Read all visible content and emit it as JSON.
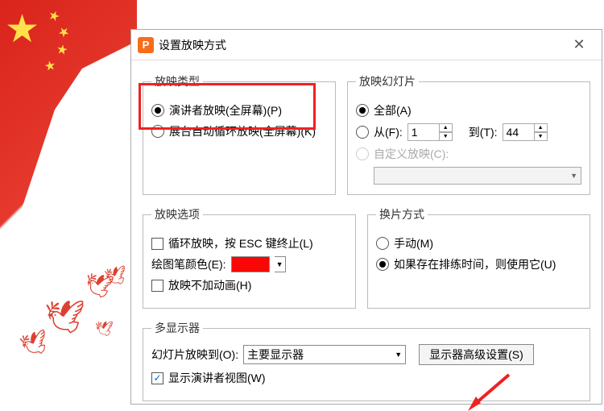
{
  "dialog": {
    "title": "设置放映方式"
  },
  "play_type": {
    "legend": "放映类型",
    "presenter": "演讲者放映(全屏幕)(P)",
    "kiosk": "展台自动循环放映(全屏幕)(K)"
  },
  "play_slides": {
    "legend": "放映幻灯片",
    "all": "全部(A)",
    "from_label": "从(F):",
    "from_value": "1",
    "to_label": "到(T):",
    "to_value": "44",
    "custom_label": "自定义放映(C):"
  },
  "play_options": {
    "legend": "放映选项",
    "loop": "循环放映，按 ESC 键终止(L)",
    "pen_color_label": "绘图笔颜色(E):",
    "no_anim": "放映不加动画(H)"
  },
  "advance": {
    "legend": "换片方式",
    "manual": "手动(M)",
    "use_timings": "如果存在排练时间，则使用它(U)"
  },
  "multi_mon": {
    "legend": "多显示器",
    "show_on_label": "幻灯片放映到(O):",
    "selected": "主要显示器",
    "adv_settings": "显示器高级设置(S)",
    "presenter_view": "显示演讲者视图(W)"
  }
}
